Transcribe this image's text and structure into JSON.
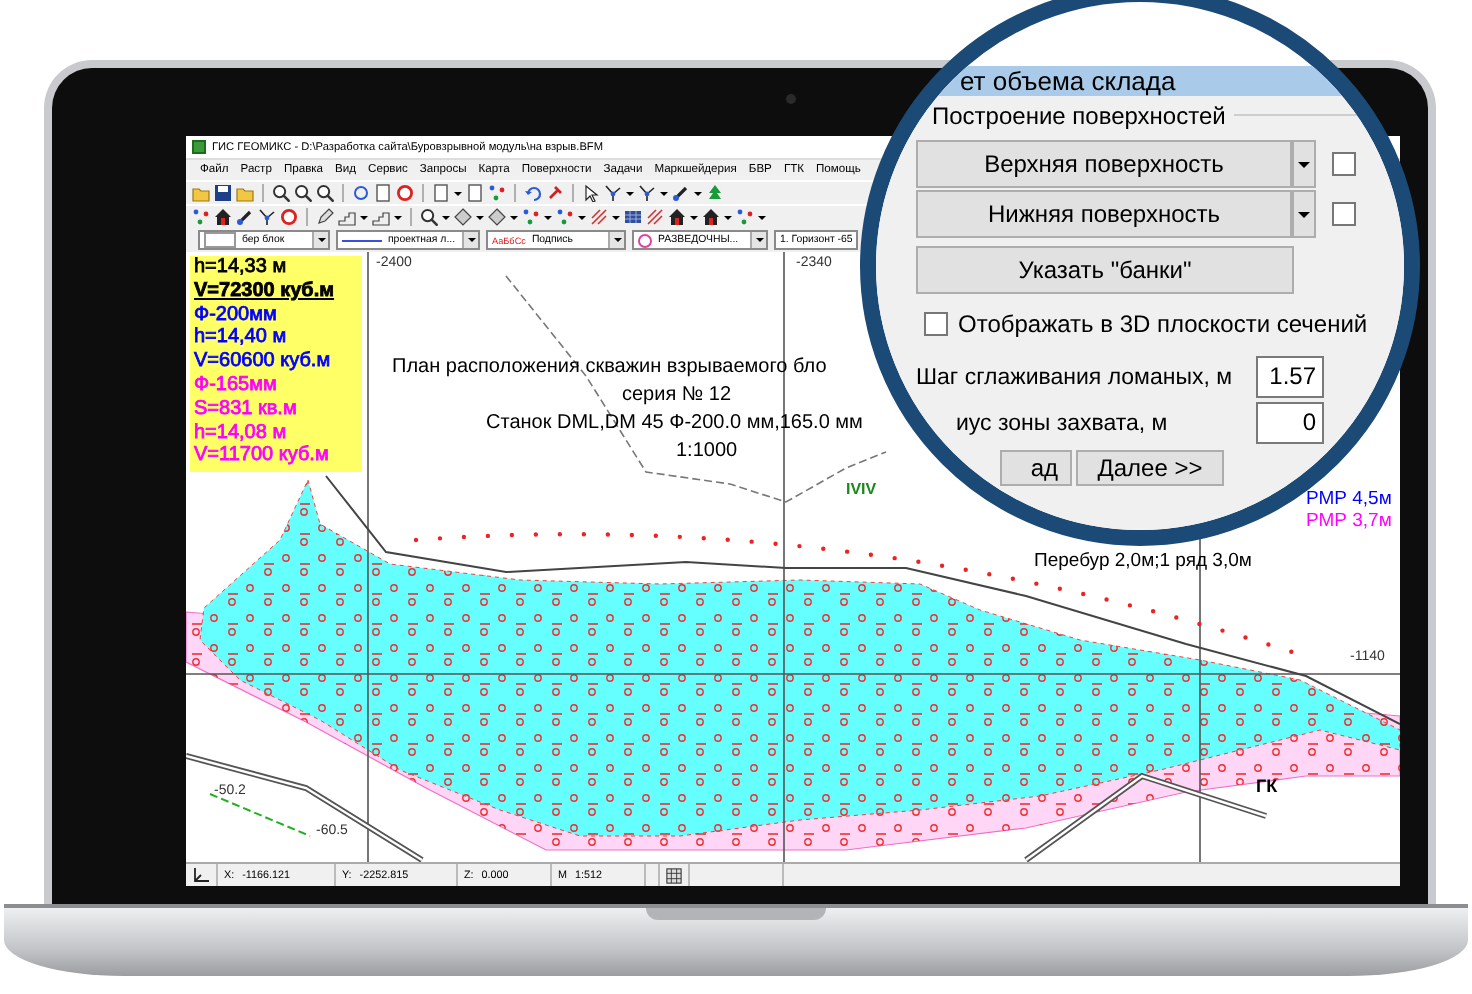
{
  "window": {
    "title": "ГИС ГЕОМИКС - D:\\Разработка сайта\\Буровзрывной модуль\\на взрыв.BFM"
  },
  "menu": [
    "Файл",
    "Растр",
    "Правка",
    "Вид",
    "Сервис",
    "Запросы",
    "Карта",
    "Поверхности",
    "Задачи",
    "Маркшейдерия",
    "БВР",
    "ГТК",
    "Помощь"
  ],
  "style_bar": [
    {
      "kind": "swatch",
      "label": "бер блок"
    },
    {
      "kind": "line",
      "label": "проектная л..."
    },
    {
      "kind": "font",
      "sample": "АаБбСс",
      "label": "Подпись"
    },
    {
      "kind": "symbol",
      "label": "РАЗВЕДОЧНЫ..."
    },
    {
      "kind": "plain",
      "label": "1. Горизонт -65"
    }
  ],
  "legend": [
    {
      "kind": "value",
      "text": "h=14,33 м"
    },
    {
      "kind": "total",
      "text": "V=72300 куб.м"
    },
    {
      "kind": "value",
      "text": "Ф-200мм",
      "color": "#0000ff"
    },
    {
      "kind": "value",
      "text": "h=14,40 м",
      "color": "#0000ff"
    },
    {
      "kind": "value",
      "text": "V=60600 куб.м",
      "color": "#0000ff"
    },
    {
      "kind": "value",
      "text": "Ф-165мм",
      "color": "#ff00ff"
    },
    {
      "kind": "value",
      "text": "S=831 кв.м",
      "color": "#ff00ff"
    },
    {
      "kind": "value",
      "text": "h=14,08 м",
      "color": "#ff00ff"
    },
    {
      "kind": "value",
      "text": "V=11700 куб.м",
      "color": "#ff00ff"
    }
  ],
  "map": {
    "title_lines": [
      "План расположения скважин взрываемого бло",
      "серия № 12",
      "Станок DML,DM 45 Ф-200.0 мм,165.0 мм",
      "1:1000"
    ],
    "grid_labels": [
      "-2400",
      "-2340",
      "-1140",
      "-50.2",
      "-60.5"
    ],
    "labels": [
      {
        "text": "IVIV",
        "color": "#1a8a1a"
      },
      {
        "text": "Перебур 2,0м;1 ряд 3,0м",
        "color": "#000000"
      },
      {
        "text": "РМР 4,5м",
        "color": "#0000ff"
      },
      {
        "text": "РМР 3,7м",
        "color": "#ff00ff"
      },
      {
        "text": "ГК",
        "color": "#000000"
      }
    ]
  },
  "dialog": {
    "title": "ет объема склада",
    "group": "Построение поверхностей",
    "surfaces": [
      {
        "label": "Верхняя поверхность",
        "checked": false
      },
      {
        "label": "Нижняя поверхность",
        "checked": false
      }
    ],
    "banks_button": "Указать \"банки\"",
    "option": {
      "label": "Отображать в 3D плоскости сечений",
      "checked": false
    },
    "fields": [
      {
        "label": "Шаг сглаживания ломаных, м",
        "value": "1.57"
      },
      {
        "label": "иус зоны захвата, м",
        "value": "0"
      }
    ],
    "buttons": [
      "ад",
      "Далее >>"
    ]
  },
  "status_bar": [
    {
      "label": "X:",
      "value": "-1166.121"
    },
    {
      "label": "Y:",
      "value": "-2252.815"
    },
    {
      "label": "Z:",
      "value": "0.000"
    },
    {
      "label": "M",
      "value": "1:512"
    }
  ]
}
